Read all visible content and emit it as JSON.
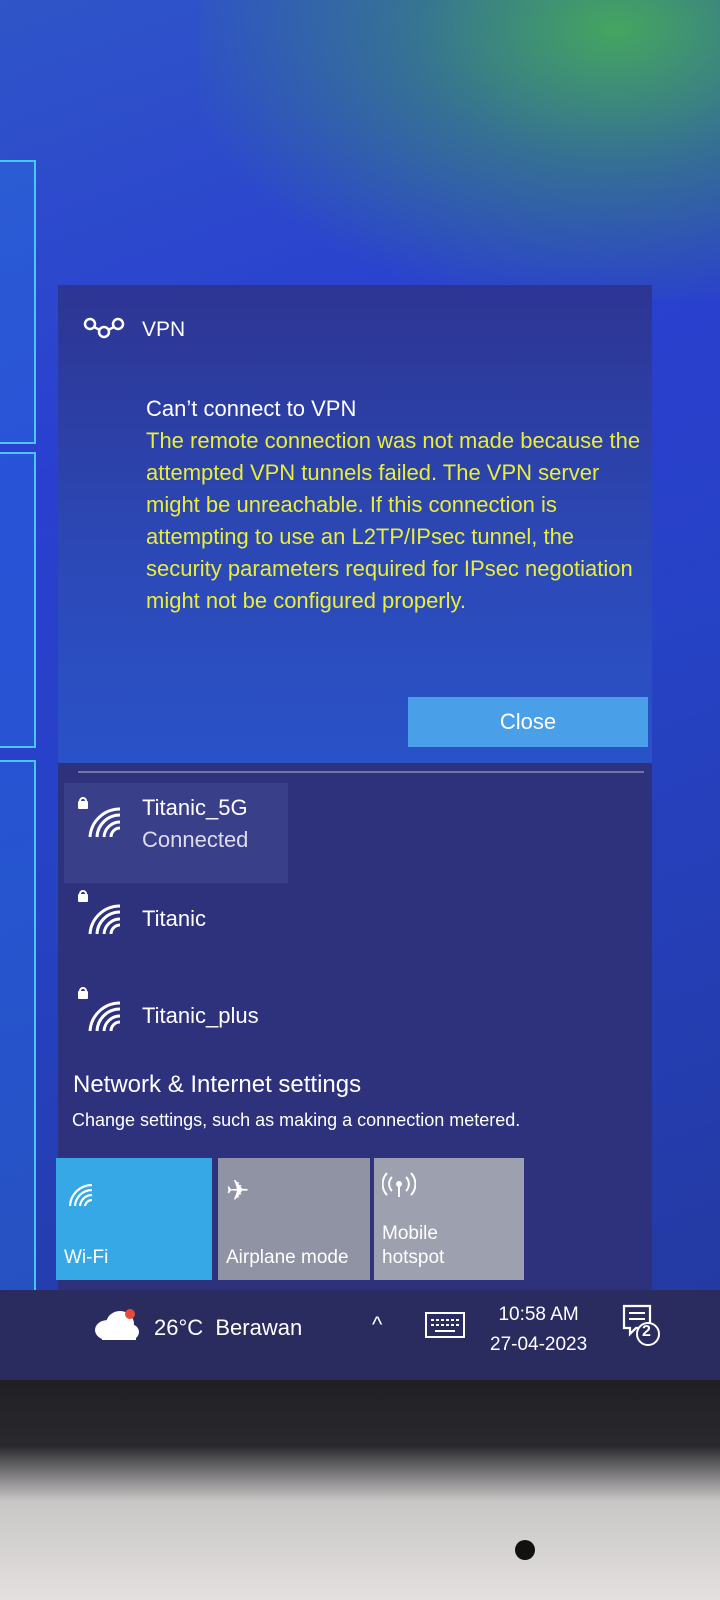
{
  "vpn_toast": {
    "title": "VPN",
    "message_title": "Can’t connect to VPN",
    "message_body": "The remote connection was not made because the attempted VPN tunnels failed. The VPN server might be unreachable. If this connection is attempting to use an L2TP/IPsec tunnel, the security parameters required for IPsec negotiation might not be configured properly.",
    "close_label": "Close",
    "accent": "#e8ee3a"
  },
  "networks": [
    {
      "name": "Titanic_5G",
      "status": "Connected"
    },
    {
      "name": "Titanic",
      "status": ""
    },
    {
      "name": "Titanic_plus",
      "status": ""
    }
  ],
  "settings": {
    "title": "Network & Internet settings",
    "subtitle": "Change settings, such as making a connection metered."
  },
  "tiles": {
    "wifi": "Wi-Fi",
    "airplane": "Airplane mode",
    "hotspot_line1": "Mobile",
    "hotspot_line2": "hotspot"
  },
  "taskbar": {
    "weather": "26°C  Berawan",
    "time": "10:58 AM",
    "date": "27-04-2023",
    "notification_count": "2"
  }
}
